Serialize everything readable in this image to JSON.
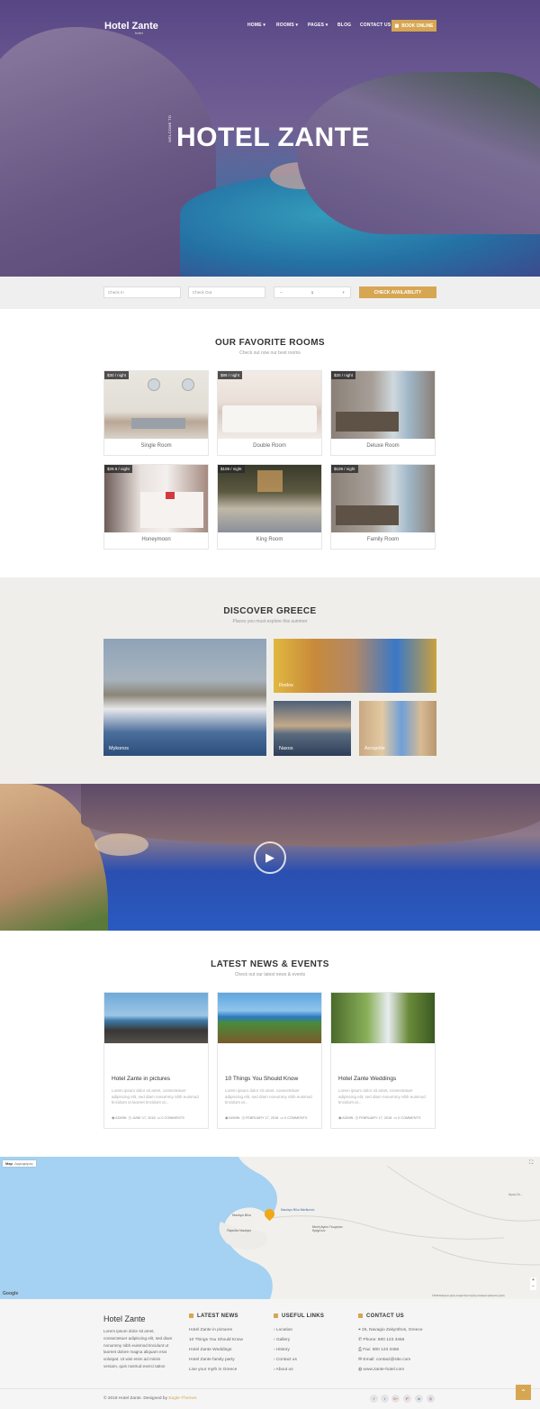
{
  "header": {
    "logo": "Hotel Zante",
    "logo_sub": "hotel",
    "nav": [
      "HOME",
      "ROOMS",
      "PAGES",
      "BLOG",
      "CONTACT US"
    ],
    "book_online": "BOOK ONLINE"
  },
  "hero": {
    "welcome": "WELCOME TO",
    "title": "HOTEL ZANTE"
  },
  "booking": {
    "check_in_placeholder": "Check In",
    "check_out_placeholder": "Check Out",
    "guests_minus": "−",
    "guests_value": "1",
    "guests_plus": "+",
    "button": "CHECK AVAILABILITY"
  },
  "rooms": {
    "title": "OUR FAVORITE ROOMS",
    "subtitle": "Check out now our best rooms",
    "items": [
      {
        "price": "$30 / night",
        "name": "Single Room"
      },
      {
        "price": "$89 / night",
        "name": "Double Room"
      },
      {
        "price": "$20 / night",
        "name": "Deluxe Room"
      },
      {
        "price": "$29.9 / night",
        "name": "Honeymoon"
      },
      {
        "price": "$109 / night",
        "name": "King Room"
      },
      {
        "price": "$109 / night",
        "name": "Family Room"
      }
    ]
  },
  "discover": {
    "title": "DISCOVER GREECE",
    "subtitle": "Places you must explore this summer",
    "places": [
      "Mykonos",
      "Rodos",
      "Naxos",
      "Acropolis"
    ]
  },
  "video": {
    "play_icon": "play-icon"
  },
  "news": {
    "title": "LATEST NEWS & EVENTS",
    "subtitle": "Check out our latest news & events",
    "posts": [
      {
        "title": "Hotel Zante in pictures",
        "excerpt": "Lorem ipsum dolor sit amet, consectetuer adipiscing elit, sed diam nonummy nibh euismod tincidunt ut laoreet tincidunt ut...",
        "author": "ADMIN",
        "date": "JUNE 17, 2018",
        "comments": "0 COMMENTS"
      },
      {
        "title": "10 Things You Should Know",
        "excerpt": "Lorem ipsum dolor sit amet, consectetuer adipiscing elit, sed diam nonummy nibh euismod tincidunt ut...",
        "author": "ADMIN",
        "date": "FEBRUARY 17, 2018",
        "comments": "0 COMMENTS"
      },
      {
        "title": "Hotel Zante Weddings",
        "excerpt": "Lorem ipsum dolor sit amet, consectetuer adipiscing elit, sed diam nonummy nibh euismod tincidunt ut...",
        "author": "ADMIN",
        "date": "FEBRUARY 17, 2018",
        "comments": "0 COMMENTS"
      }
    ]
  },
  "map": {
    "tab_map": "Map",
    "tab_satellite": "Δορυφόρος",
    "label_1": "Ναυάγιο Βίλα",
    "label_2": "Ναυάγιο Βίλα Μισθωτού",
    "label_3": "Παραλία Ναυάγιο",
    "label_4": "Μονή Αγίου Γεωργίου Κρημνών",
    "label_5": "Αγιος Νι...",
    "google": "Google",
    "attribution": "©2018 Δεδομένα χάρτη Google   Όροι Χρήσης   Αναφορά σφάλματος χάρτη",
    "zoom_in": "+",
    "zoom_out": "−"
  },
  "footer": {
    "brand": "Hotel Zante",
    "about": "Lorem ipsum dolor sit amet, consectetuer adipiscing elit, sed diam nonummy nibh euismod tincidunt ut laoreet dolore magna aliquam erat volutpat. Ut wisi enim ad minim veniam, quis nostrud exerci tation",
    "latest_news_title": "LATEST NEWS",
    "latest_news": [
      "Hotel Zante in pictures",
      "10 Things You Should Know",
      "Hotel Zante Weddings",
      "Hotel Zante family party",
      "Live your myth in Greece"
    ],
    "useful_links_title": "USEFUL LINKS",
    "useful_links": [
      "Location",
      "Gallery",
      "History",
      "Contact us",
      "About us"
    ],
    "contact_title": "CONTACT US",
    "contact": [
      "25, Navagio Zakynthos, Greece",
      "Phone: 800 123 3456",
      "Fax: 800 123 3456",
      "Email: contact@site.com",
      "www.zante-hotel.com"
    ],
    "copyright": "© 2018 Hotel Zante. Designed by",
    "designer": "Eagle-Themes",
    "social": [
      "facebook-icon",
      "twitter-icon",
      "google-plus-icon",
      "pinterest-icon",
      "linkedin-icon",
      "instagram-icon"
    ],
    "social_glyphs": [
      "f",
      "t",
      "G+",
      "P",
      "in",
      "◎"
    ]
  },
  "colors": {
    "accent": "#d6a652",
    "footer_bg": "#f5f5f5",
    "discover_bg": "#efeeeb"
  }
}
